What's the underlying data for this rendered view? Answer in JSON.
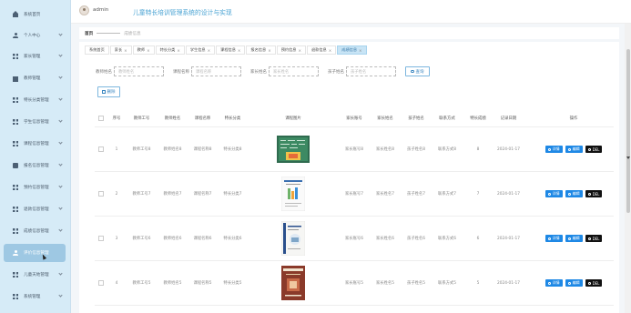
{
  "header": {
    "username": "admin",
    "title": "儿童特长培训管理系统的设计与实现"
  },
  "sidebar": {
    "items": [
      {
        "label": "系统首页",
        "icon": "home-icon"
      },
      {
        "label": "个人中心",
        "icon": "person-icon"
      },
      {
        "label": "家长管理",
        "icon": "grid-icon"
      },
      {
        "label": "教师管理",
        "icon": "bank-icon"
      },
      {
        "label": "特长分类管理",
        "icon": "grid-icon"
      },
      {
        "label": "学生信息管理",
        "icon": "grid-icon"
      },
      {
        "label": "课程信息管理",
        "icon": "grid-icon"
      },
      {
        "label": "报名信息管理",
        "icon": "box-icon"
      },
      {
        "label": "预约信息管理",
        "icon": "grid-icon"
      },
      {
        "label": "退款信息管理",
        "icon": "grid-icon"
      },
      {
        "label": "成绩信息管理",
        "icon": "grid-icon"
      },
      {
        "label": "评价信息管理",
        "icon": "person-icon"
      },
      {
        "label": "儿童天地管理",
        "icon": "grid-icon"
      },
      {
        "label": "系统管理",
        "icon": "grid-icon"
      }
    ],
    "active_index": 11
  },
  "breadcrumb": {
    "home": "首页",
    "current": "成绩信息"
  },
  "tags": [
    {
      "label": "系统首页",
      "closable": false
    },
    {
      "label": "家长",
      "closable": true
    },
    {
      "label": "教师",
      "closable": true
    },
    {
      "label": "特长分类",
      "closable": true
    },
    {
      "label": "学生信息",
      "closable": true
    },
    {
      "label": "课程信息",
      "closable": true
    },
    {
      "label": "报名信息",
      "closable": true
    },
    {
      "label": "预约信息",
      "closable": true
    },
    {
      "label": "退款信息",
      "closable": true
    },
    {
      "label": "成绩信息",
      "closable": true,
      "active": true
    }
  ],
  "search": {
    "fields": [
      {
        "label": "教师姓名",
        "placeholder": "教师姓名"
      },
      {
        "label": "课程名称",
        "placeholder": "课程名称"
      },
      {
        "label": "家长姓名",
        "placeholder": "家长姓名"
      },
      {
        "label": "孩子姓名",
        "placeholder": "孩子姓名"
      }
    ],
    "button": "查询"
  },
  "delete_button": "删除",
  "table": {
    "headers": [
      "序号",
      "教师工号",
      "教师姓名",
      "课程名称",
      "特长分类",
      "课程图片",
      "家长账号",
      "家长姓名",
      "孩子姓名",
      "联系方式",
      "特长成绩",
      "记录日期",
      "操作"
    ],
    "rows": [
      {
        "no": "1",
        "teacher_id": "教师工号8",
        "teacher_name": "教师姓名8",
        "course": "课程名称8",
        "category": "特长分类8",
        "parent_account": "家长账号8",
        "parent_name": "家长姓名8",
        "child": "孩子姓名8",
        "contact": "联系方式8",
        "score": "8",
        "date": "2024-01-17"
      },
      {
        "no": "2",
        "teacher_id": "教师工号7",
        "teacher_name": "教师姓名7",
        "course": "课程名称7",
        "category": "特长分类7",
        "parent_account": "家长账号7",
        "parent_name": "家长姓名7",
        "child": "孩子姓名7",
        "contact": "联系方式7",
        "score": "7",
        "date": "2024-01-17"
      },
      {
        "no": "3",
        "teacher_id": "教师工号6",
        "teacher_name": "教师姓名6",
        "course": "课程名称6",
        "category": "特长分类6",
        "parent_account": "家长账号6",
        "parent_name": "家长姓名6",
        "child": "孩子姓名6",
        "contact": "联系方式6",
        "score": "6",
        "date": "2024-01-17"
      },
      {
        "no": "4",
        "teacher_id": "教师工号5",
        "teacher_name": "教师姓名5",
        "course": "课程名称5",
        "category": "特长分类5",
        "parent_account": "家长账号5",
        "parent_name": "家长姓名5",
        "child": "孩子姓名5",
        "contact": "联系方式5",
        "score": "5",
        "date": "2024-01-17"
      }
    ],
    "actions": {
      "detail": "详情",
      "edit": "编辑",
      "del": "DEL"
    }
  },
  "colors": {
    "sidebar_bg": "#d6ebf7",
    "accent": "#1e88e5",
    "title": "#4aa3d3",
    "active_tag": "#c8e4f5"
  }
}
